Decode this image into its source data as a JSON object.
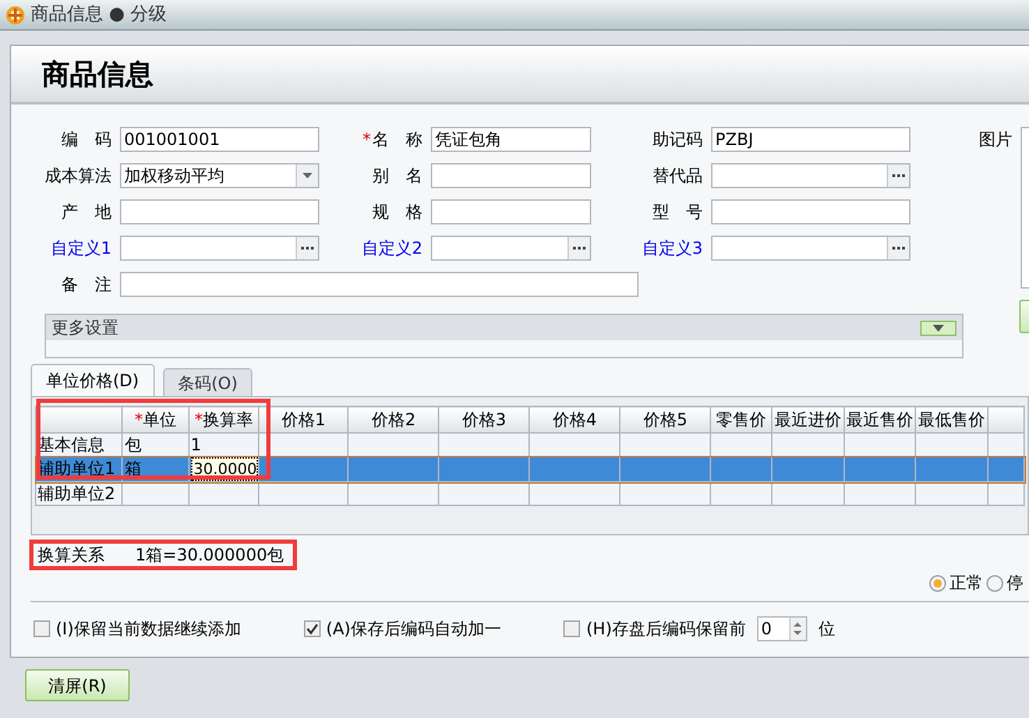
{
  "window": {
    "title": "商品信息 ● 分级"
  },
  "header": {
    "title": "商品信息"
  },
  "form_rows": [
    [
      {
        "label": "编　码",
        "kind": "text",
        "value": "001001001",
        "custom": false
      },
      {
        "label": "名　称",
        "kind": "text",
        "value": "凭证包角",
        "mark": "*",
        "custom": false
      },
      {
        "label": "助记码",
        "kind": "text",
        "value": "PZBJ",
        "custom": false
      }
    ],
    [
      {
        "label": "成本算法",
        "kind": "dropdown",
        "value": "加权移动平均",
        "custom": false
      },
      {
        "label": "别　名",
        "kind": "text",
        "custom": false
      },
      {
        "label": "替代品",
        "kind": "lookup",
        "custom": false
      }
    ],
    [
      {
        "label": "产　地",
        "kind": "text",
        "custom": false
      },
      {
        "label": "规　格",
        "kind": "text",
        "custom": false
      },
      {
        "label": "型　号",
        "kind": "text",
        "custom": false
      }
    ],
    [
      {
        "label": "自定义1",
        "kind": "lookup",
        "custom": true
      },
      {
        "label": "自定义2",
        "kind": "lookup",
        "custom": true
      },
      {
        "label": "自定义3",
        "kind": "lookup",
        "custom": true
      }
    ]
  ],
  "note": {
    "label": "备　注"
  },
  "image": {
    "label": "图片"
  },
  "more_settings": {
    "label": "更多设置",
    "expanded": false
  },
  "tabs": [
    {
      "label": "单位价格(D)",
      "selected": true
    },
    {
      "label": "条码(O)",
      "selected": false
    }
  ],
  "grid": {
    "columns": [
      {},
      {
        "label": "单位",
        "mark": "*"
      },
      {
        "label": "换算率",
        "mark": "*"
      },
      {
        "label": "价格1"
      },
      {
        "label": "价格2"
      },
      {
        "label": "价格3"
      },
      {
        "label": "价格4"
      },
      {
        "label": "价格5"
      },
      {
        "label": "零售价"
      },
      {
        "label": "最近进价"
      },
      {
        "label": "最近售价"
      },
      {
        "label": "最低售价"
      }
    ],
    "rows": [
      {
        "cells": [
          "基本信息",
          "包",
          "1",
          null,
          null,
          null,
          null,
          null,
          null,
          null,
          null,
          null
        ],
        "selected": false
      },
      {
        "cells": [
          "辅助单位1",
          "箱",
          "30.0000",
          null,
          null,
          null,
          null,
          null,
          null,
          null,
          null,
          null
        ],
        "selected": true
      },
      {
        "cells": [
          "辅助单位2",
          null,
          null,
          null,
          null,
          null,
          null,
          null,
          null,
          null,
          null,
          null
        ],
        "selected": false
      }
    ]
  },
  "conversion": {
    "label": "换算关系",
    "value": "1箱=30.000000包"
  },
  "status_radios": [
    {
      "label": "正常",
      "selected": true
    },
    {
      "label": "停",
      "selected": false
    }
  ],
  "options": [
    {
      "kind": "checkbox",
      "label": "(I)保留当前数据继续添加",
      "checked": false
    },
    {
      "kind": "checkbox",
      "label": "(A)保存后编码自动加一",
      "checked": true
    },
    {
      "kind": "spin",
      "label": "(H)存盘后编码保留前",
      "checked": false,
      "value": "0",
      "unit": "位"
    }
  ],
  "buttons": [
    {
      "label": "清屏(R)"
    }
  ]
}
